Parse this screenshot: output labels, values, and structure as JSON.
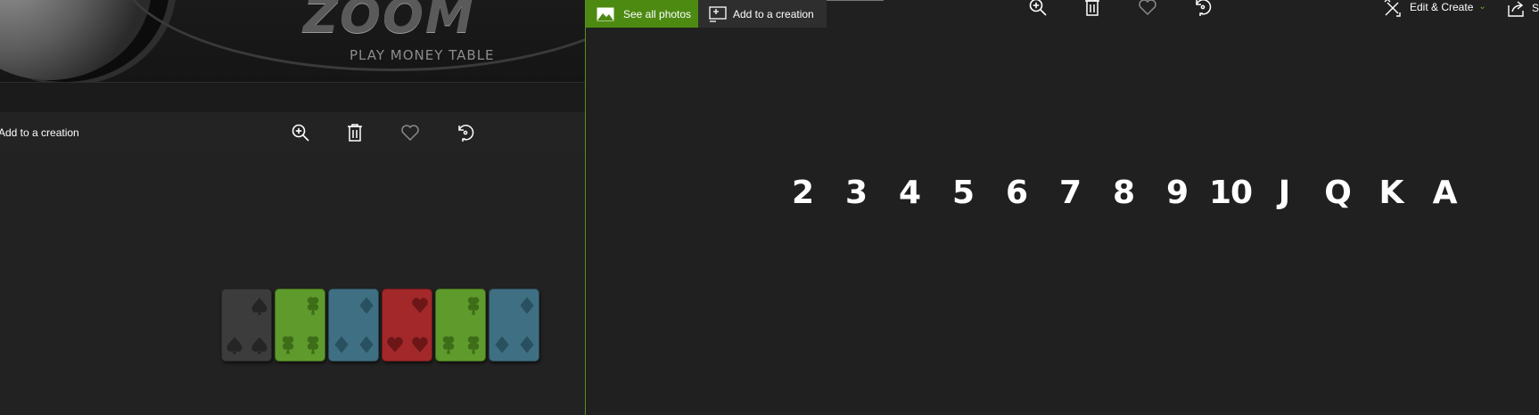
{
  "left_window": {
    "banner": {
      "logo_text": "ZOOM",
      "subtitle": "PLAY MONEY TABLE"
    },
    "toolbar": {
      "add_to_creation_label": "Add to a creation",
      "icons": [
        "zoom-in-icon",
        "delete-icon",
        "favorite-icon",
        "rotate-icon"
      ]
    },
    "cards": [
      {
        "suit": "spade",
        "color": "#3c3c3c",
        "pip": "#252525"
      },
      {
        "suit": "club",
        "color": "#5f9b2c",
        "pip": "#3d6d18"
      },
      {
        "suit": "diamond",
        "color": "#3f6f82",
        "pip": "#28505f"
      },
      {
        "suit": "heart",
        "color": "#a2282a",
        "pip": "#6d1617"
      },
      {
        "suit": "club",
        "color": "#5f9b2c",
        "pip": "#3d6d18"
      },
      {
        "suit": "diamond",
        "color": "#3f6f82",
        "pip": "#28505f"
      }
    ]
  },
  "right_window": {
    "see_all_photos_label": "See all photos",
    "add_to_creation_label": "Add to a creation",
    "edit_create_label": "Edit & Create",
    "share_label": "S",
    "toolbar_icons": [
      "zoom-in-icon",
      "delete-icon",
      "favorite-icon",
      "rotate-icon"
    ],
    "ranks": [
      "2",
      "3",
      "4",
      "5",
      "6",
      "7",
      "8",
      "9",
      "10",
      "J",
      "Q",
      "K",
      "A"
    ]
  },
  "colors": {
    "accent_green": "#4d8a12",
    "background": "#202020"
  }
}
